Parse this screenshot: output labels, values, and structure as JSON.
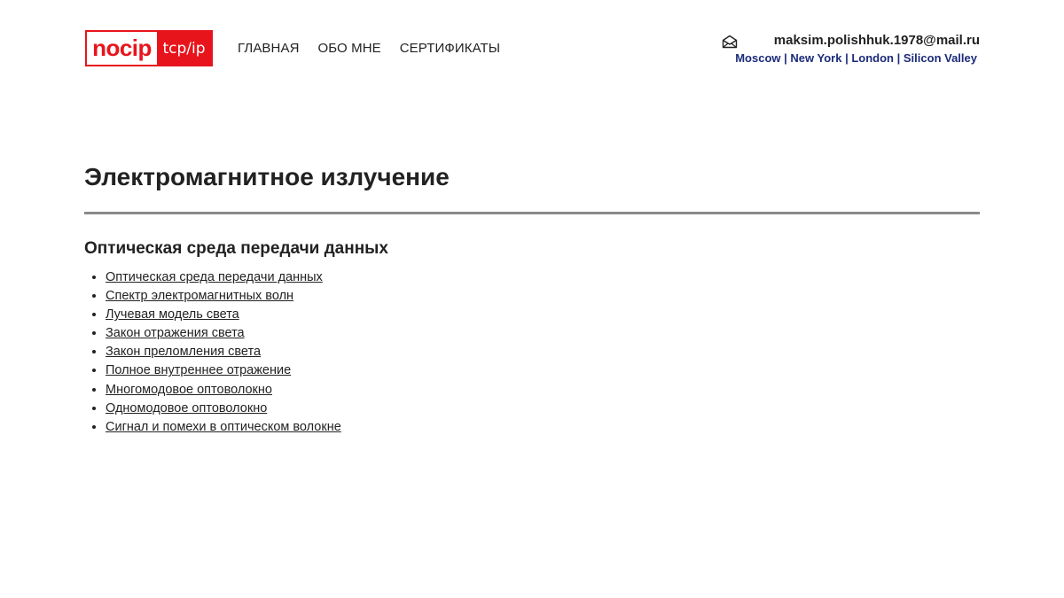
{
  "header": {
    "logo": {
      "left": "nocip",
      "right": "tcp/ip"
    },
    "nav": [
      {
        "label": "ГЛАВНАЯ"
      },
      {
        "label": "ОБО МНЕ"
      },
      {
        "label": "СЕРТИФИКАТЫ"
      }
    ],
    "contact": {
      "email": "maksim.polishhuk.1978@mail.ru",
      "cities": [
        "Moscow",
        "New York",
        "London",
        "Silicon Valley"
      ],
      "separator": "|"
    }
  },
  "main": {
    "title": "Электромагнитное излучение",
    "section_title": "Оптическая среда передачи данных",
    "links": [
      "Оптическая среда передачи данных",
      "Спектр электромагнитных волн",
      "Лучевая модель света",
      "Закон отражения света",
      "Закон преломления света",
      "Полное внутреннее отражение",
      "Многомодовое оптоволокно",
      "Одномодовое оптоволокно",
      "Сигнал и помехи в оптическом волокне"
    ]
  },
  "colors": {
    "brand_red": "#e8141c",
    "city_link": "#1c2b7a",
    "divider": "#8a8a8a"
  },
  "icons": {
    "mail": "envelope-icon"
  }
}
